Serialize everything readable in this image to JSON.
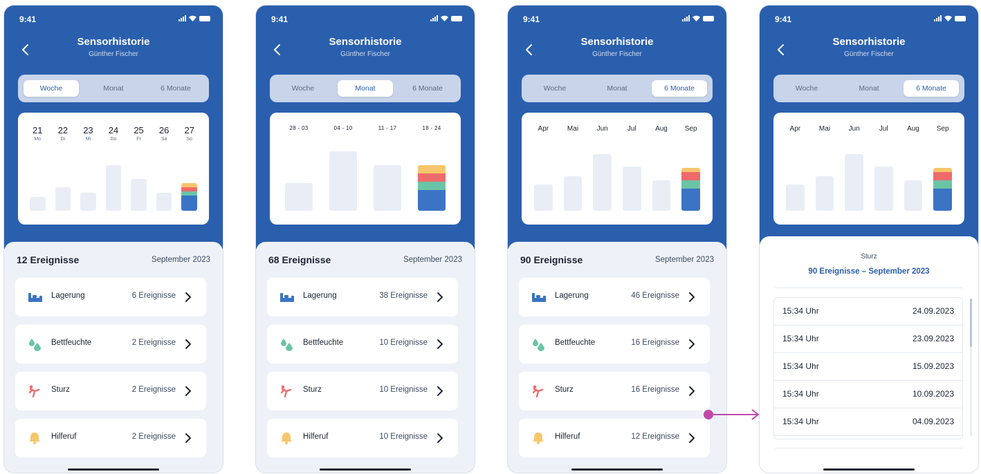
{
  "status": {
    "time": "9:41"
  },
  "header": {
    "title": "Sensorhistorie",
    "subtitle": "Günther Fischer"
  },
  "tabs": [
    "Woche",
    "Monat",
    "6 Monate"
  ],
  "colors": {
    "primary": "#2a5fae",
    "bar_bg": "#e9eef6",
    "lagerung": "#3b74c4",
    "bettfeuchte": "#6ac4a6",
    "sturz": "#ef6b6b",
    "hilferuf": "#f7c66b",
    "arrow": "#c04aa8"
  },
  "category_icons": [
    "bed-icon",
    "droplets-icon",
    "fall-icon",
    "bell-icon"
  ],
  "screens": [
    {
      "active_tab": 0,
      "columns": [
        {
          "n": "21",
          "d": "Mo"
        },
        {
          "n": "22",
          "d": "Di"
        },
        {
          "n": "23",
          "d": "Mi"
        },
        {
          "n": "24",
          "d": "Do"
        },
        {
          "n": "25",
          "d": "Fr"
        },
        {
          "n": "26",
          "d": "Sa"
        },
        {
          "n": "27",
          "d": "So"
        }
      ],
      "count_label": "12 Ereignisse",
      "period": "September 2023",
      "items": [
        {
          "label": "Lagerung",
          "count": "6 Ereignisse"
        },
        {
          "label": "Bettfeuchte",
          "count": "2 Ereignisse"
        },
        {
          "label": "Sturz",
          "count": "2 Ereignisse"
        },
        {
          "label": "Hilferuf",
          "count": "2 Ereignisse"
        }
      ]
    },
    {
      "active_tab": 1,
      "columns": [
        {
          "r": "28 - 03"
        },
        {
          "r": "04 - 10"
        },
        {
          "r": "11 - 17"
        },
        {
          "r": "18 - 24"
        }
      ],
      "count_label": "68 Ereignisse",
      "period": "September 2023",
      "items": [
        {
          "label": "Lagerung",
          "count": "38 Ereignisse"
        },
        {
          "label": "Bettfeuchte",
          "count": "10 Ereignisse"
        },
        {
          "label": "Sturz",
          "count": "10 Ereignisse"
        },
        {
          "label": "Hilferuf",
          "count": "10 Ereignisse"
        }
      ]
    },
    {
      "active_tab": 2,
      "columns": [
        {
          "m": "Apr"
        },
        {
          "m": "Mai"
        },
        {
          "m": "Jun"
        },
        {
          "m": "Jul"
        },
        {
          "m": "Aug"
        },
        {
          "m": "Sep"
        }
      ],
      "count_label": "90 Ereignisse",
      "period": "September 2023",
      "items": [
        {
          "label": "Lagerung",
          "count": "46 Ereignisse"
        },
        {
          "label": "Bettfeuchte",
          "count": "16 Ereignisse"
        },
        {
          "label": "Sturz",
          "count": "16 Ereignisse"
        },
        {
          "label": "Hilferuf",
          "count": "12 Ereignisse"
        }
      ]
    },
    {
      "active_tab": 2,
      "columns": [
        {
          "m": "Apr"
        },
        {
          "m": "Mai"
        },
        {
          "m": "Jun"
        },
        {
          "m": "Jul"
        },
        {
          "m": "Aug"
        },
        {
          "m": "Sep"
        }
      ],
      "sheet": {
        "label": "Sturz",
        "title": "90 Ereignisse – September 2023",
        "rows": [
          {
            "time": "15:34 Uhr",
            "date": "24.09.2023"
          },
          {
            "time": "15:34 Uhr",
            "date": "23.09.2023"
          },
          {
            "time": "15:34 Uhr",
            "date": "15.09.2023"
          },
          {
            "time": "15:34 Uhr",
            "date": "10.09.2023"
          },
          {
            "time": "15:34 Uhr",
            "date": "04.09.2023"
          }
        ]
      }
    }
  ]
}
